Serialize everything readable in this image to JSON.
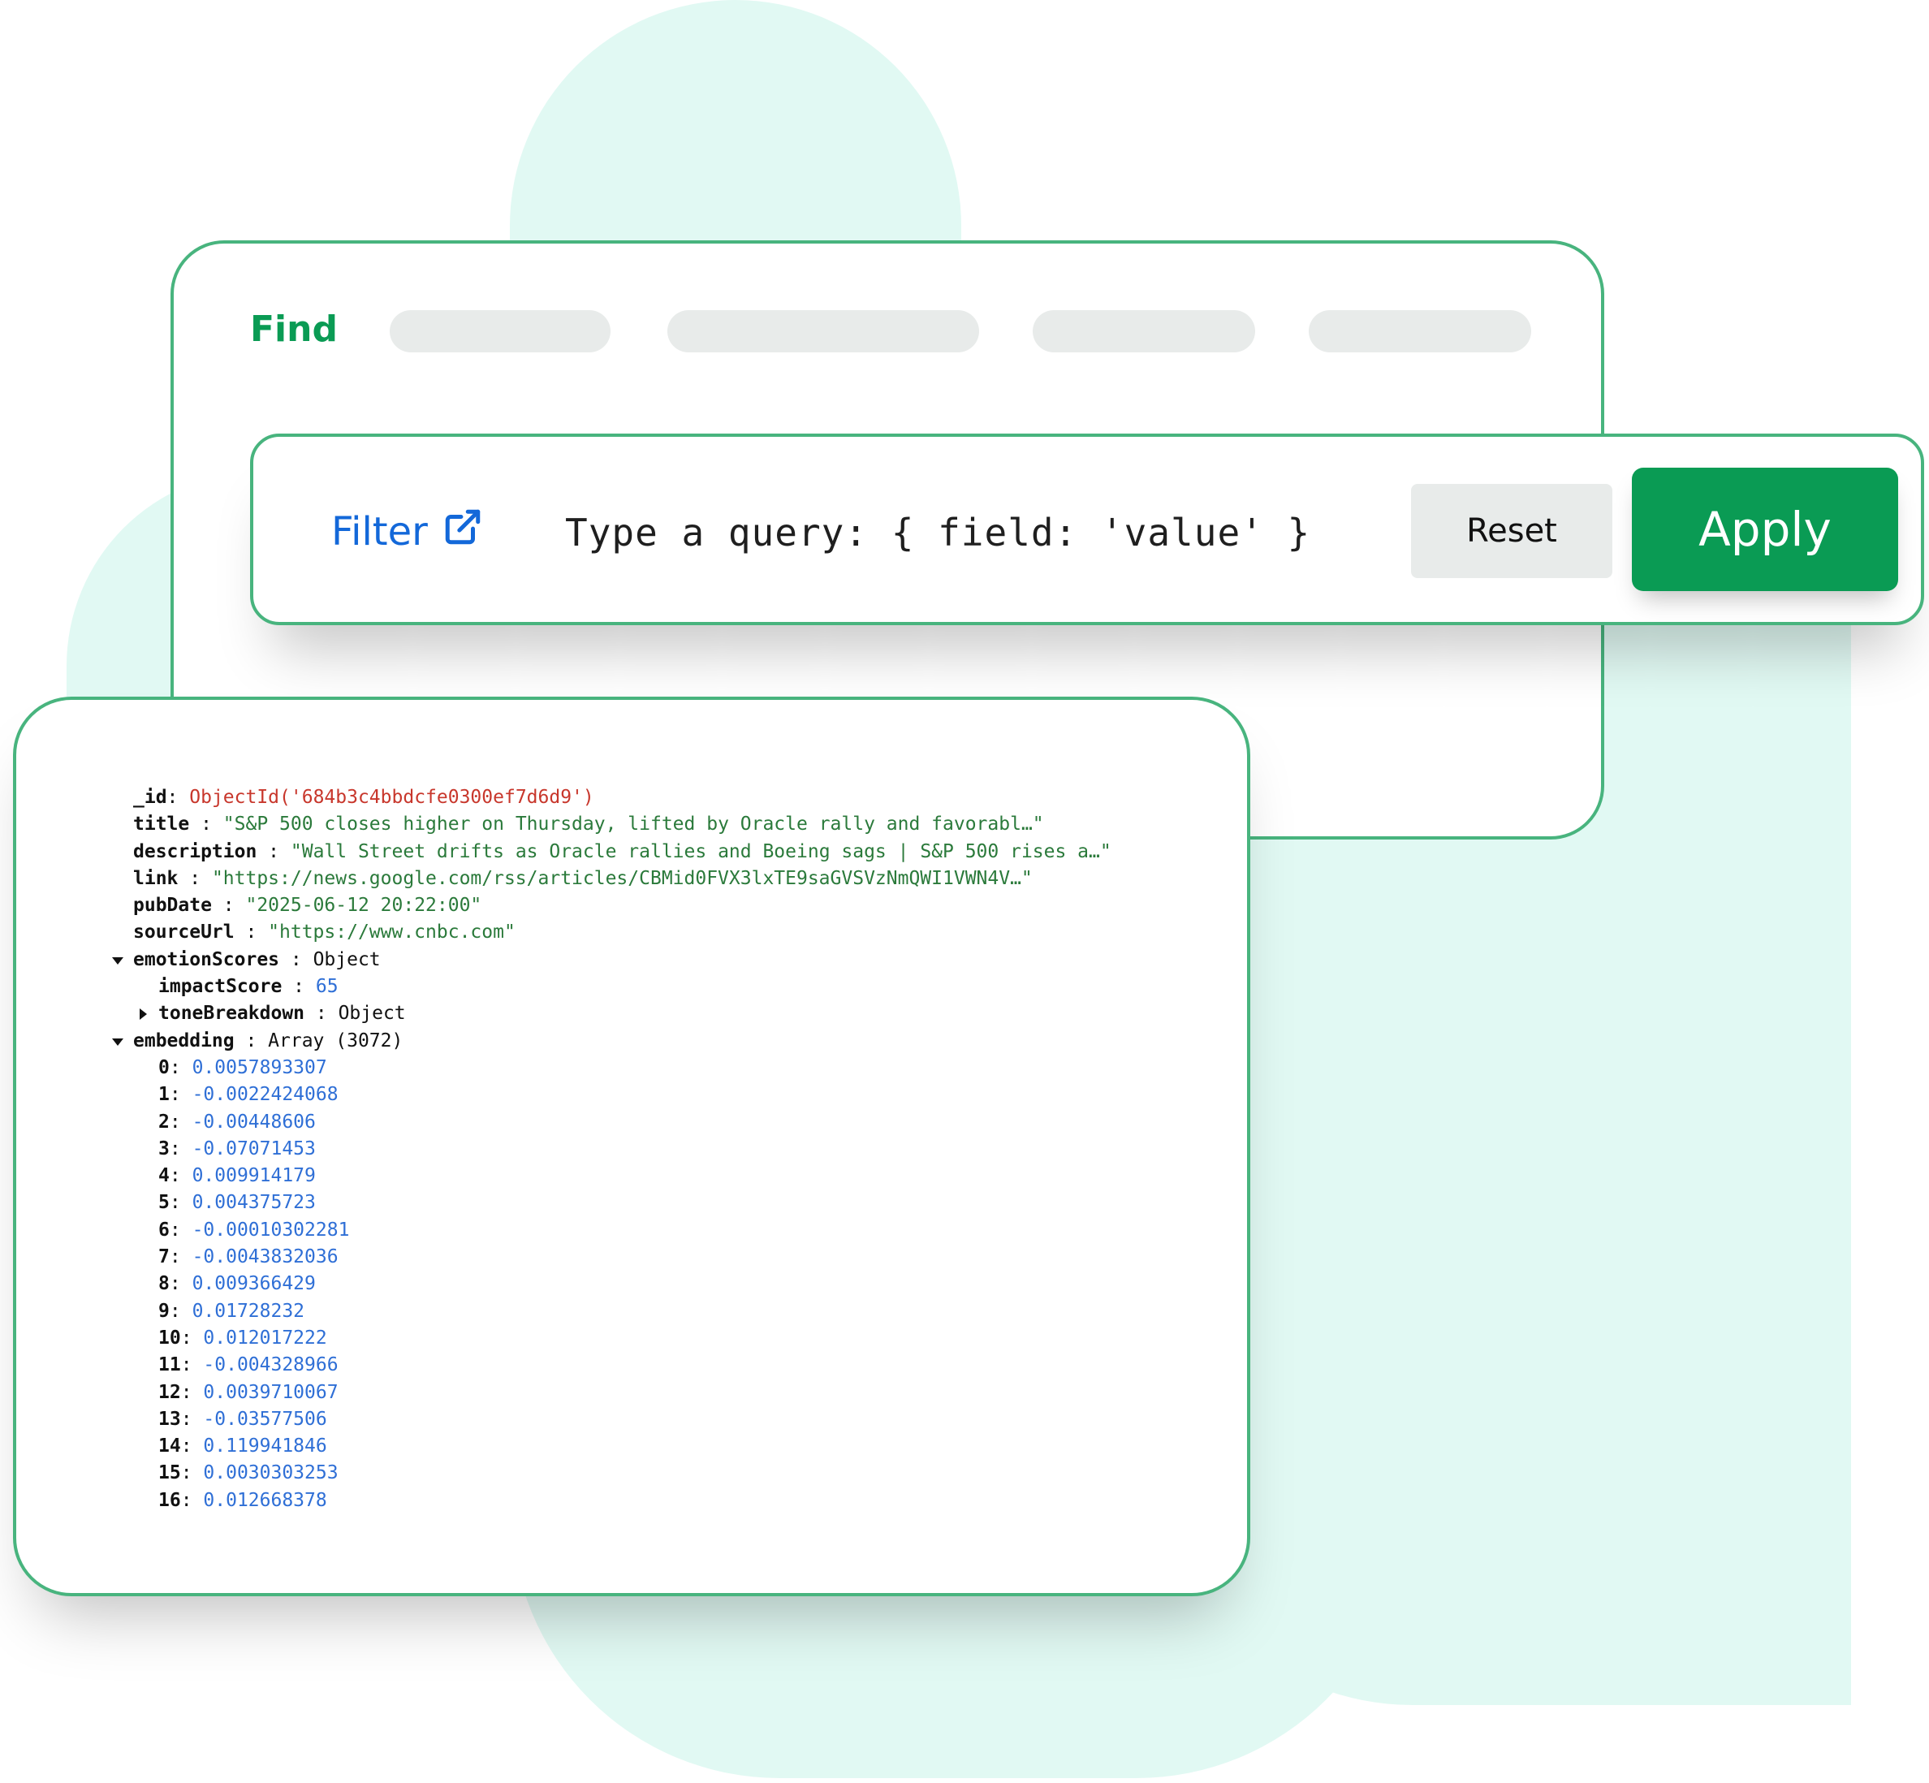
{
  "find_panel": {
    "title": "Find"
  },
  "filter_bar": {
    "filter_label": "Filter",
    "query_placeholder": "Type a query: { field: 'value' }",
    "reset_label": "Reset",
    "apply_label": "Apply"
  },
  "document": {
    "fields": [
      {
        "key": "_id",
        "sep": ": ",
        "value": "ObjectId('684b3c4bbdcfe0300ef7d6d9')"
      },
      {
        "key": "title",
        "sep": " : ",
        "value": "\"S&P 500 closes higher on Thursday, lifted by Oracle rally and favorabl…\""
      },
      {
        "key": "description",
        "sep": " : ",
        "value": "\"Wall Street drifts as Oracle rallies and Boeing sags | S&P 500 rises a…\""
      },
      {
        "key": "link",
        "sep": " : ",
        "value": "\"https://news.google.com/rss/articles/CBMid0FVX3lxTE9saGVSVzNmQWI1VWN4V…\""
      },
      {
        "key": "pubDate",
        "sep": " : ",
        "value": "\"2025-06-12 20:22:00\""
      },
      {
        "key": "sourceUrl",
        "sep": " : ",
        "value": "\"https://www.cnbc.com\""
      }
    ],
    "emotion_scores": {
      "key": "emotionScores",
      "type": "Object",
      "impact_key": "impactScore",
      "impact_value": "65",
      "tone_key": "toneBreakdown",
      "tone_type": "Object"
    },
    "embedding": {
      "key": "embedding",
      "type": "Array (3072)",
      "items": [
        {
          "i": "0",
          "v": "0.0057893307"
        },
        {
          "i": "1",
          "v": "-0.0022424068"
        },
        {
          "i": "2",
          "v": "-0.00448606"
        },
        {
          "i": "3",
          "v": "-0.07071453"
        },
        {
          "i": "4",
          "v": "0.009914179"
        },
        {
          "i": "5",
          "v": "0.004375723"
        },
        {
          "i": "6",
          "v": "-0.00010302281"
        },
        {
          "i": "7",
          "v": "-0.0043832036"
        },
        {
          "i": "8",
          "v": "0.009366429"
        },
        {
          "i": "9",
          "v": "0.01728232"
        },
        {
          "i": "10",
          "v": "0.012017222"
        },
        {
          "i": "11",
          "v": "-0.004328966"
        },
        {
          "i": "12",
          "v": "0.0039710067"
        },
        {
          "i": "13",
          "v": "-0.03577506"
        },
        {
          "i": "14",
          "v": "0.119941846"
        },
        {
          "i": "15",
          "v": "0.0030303253"
        },
        {
          "i": "16",
          "v": "0.012668378"
        }
      ]
    }
  },
  "colors": {
    "brand_green": "#0a9b54",
    "border_green": "#48b47e",
    "link_blue": "#1368d9",
    "background_mint": "#e1f9f3"
  }
}
